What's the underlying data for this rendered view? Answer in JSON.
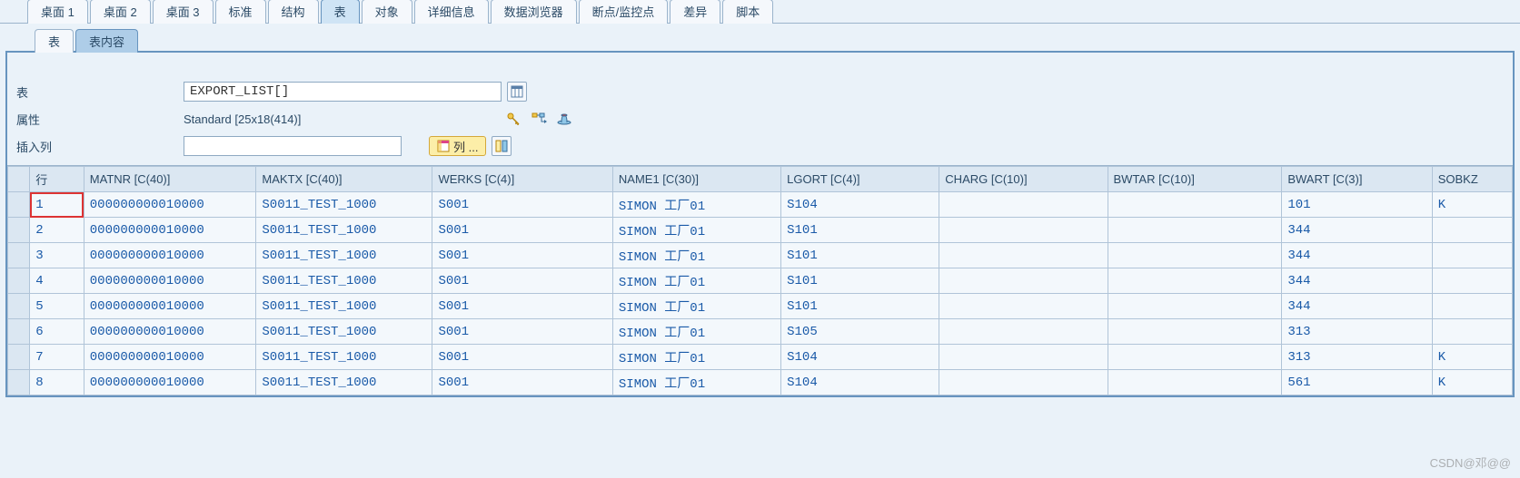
{
  "top_tabs": [
    {
      "label": "桌面 1"
    },
    {
      "label": "桌面 2"
    },
    {
      "label": "桌面 3"
    },
    {
      "label": "标准"
    },
    {
      "label": "结构"
    },
    {
      "label": "表",
      "active": true
    },
    {
      "label": "对象"
    },
    {
      "label": "详细信息"
    },
    {
      "label": "数据浏览器"
    },
    {
      "label": "断点/监控点"
    },
    {
      "label": "差异"
    },
    {
      "label": "脚本"
    }
  ],
  "sub_tabs": [
    {
      "label": "表"
    },
    {
      "label": "表内容",
      "active": true
    }
  ],
  "form": {
    "table_label": "表",
    "table_value": "EXPORT_LIST[]",
    "attr_label": "属性",
    "attr_value": "Standard [25x18(414)]",
    "insert_label": "插入列",
    "insert_value": "",
    "col_button_label": "列 ..."
  },
  "grid": {
    "row_header": "行",
    "columns": [
      {
        "key": "MATNR",
        "label": "MATNR [C(40)]",
        "cls": "col-matnr"
      },
      {
        "key": "MAKTX",
        "label": "MAKTX [C(40)]",
        "cls": "col-maktx"
      },
      {
        "key": "WERKS",
        "label": "WERKS [C(4)]",
        "cls": "col-werks"
      },
      {
        "key": "NAME1",
        "label": "NAME1 [C(30)]",
        "cls": "col-name1"
      },
      {
        "key": "LGORT",
        "label": "LGORT [C(4)]",
        "cls": "col-lgort"
      },
      {
        "key": "CHARG",
        "label": "CHARG [C(10)]",
        "cls": "col-charg"
      },
      {
        "key": "BWTAR",
        "label": "BWTAR [C(10)]",
        "cls": "col-bwtar"
      },
      {
        "key": "BWART",
        "label": "BWART [C(3)]",
        "cls": "col-bwart"
      },
      {
        "key": "SOBKZ",
        "label": "SOBKZ",
        "cls": "col-sobkz"
      }
    ],
    "rows": [
      {
        "n": "1",
        "active": true,
        "MATNR": "000000000010000",
        "MAKTX": "S0011_TEST_1000",
        "WERKS": "S001",
        "NAME1": "SIMON 工厂01",
        "LGORT": "S104",
        "CHARG": "",
        "BWTAR": "",
        "BWART": "101",
        "SOBKZ": "K"
      },
      {
        "n": "2",
        "MATNR": "000000000010000",
        "MAKTX": "S0011_TEST_1000",
        "WERKS": "S001",
        "NAME1": "SIMON 工厂01",
        "LGORT": "S101",
        "CHARG": "",
        "BWTAR": "",
        "BWART": "344",
        "SOBKZ": ""
      },
      {
        "n": "3",
        "MATNR": "000000000010000",
        "MAKTX": "S0011_TEST_1000",
        "WERKS": "S001",
        "NAME1": "SIMON 工厂01",
        "LGORT": "S101",
        "CHARG": "",
        "BWTAR": "",
        "BWART": "344",
        "SOBKZ": ""
      },
      {
        "n": "4",
        "MATNR": "000000000010000",
        "MAKTX": "S0011_TEST_1000",
        "WERKS": "S001",
        "NAME1": "SIMON 工厂01",
        "LGORT": "S101",
        "CHARG": "",
        "BWTAR": "",
        "BWART": "344",
        "SOBKZ": ""
      },
      {
        "n": "5",
        "MATNR": "000000000010000",
        "MAKTX": "S0011_TEST_1000",
        "WERKS": "S001",
        "NAME1": "SIMON 工厂01",
        "LGORT": "S101",
        "CHARG": "",
        "BWTAR": "",
        "BWART": "344",
        "SOBKZ": ""
      },
      {
        "n": "6",
        "MATNR": "000000000010000",
        "MAKTX": "S0011_TEST_1000",
        "WERKS": "S001",
        "NAME1": "SIMON 工厂01",
        "LGORT": "S105",
        "CHARG": "",
        "BWTAR": "",
        "BWART": "313",
        "SOBKZ": ""
      },
      {
        "n": "7",
        "MATNR": "000000000010000",
        "MAKTX": "S0011_TEST_1000",
        "WERKS": "S001",
        "NAME1": "SIMON 工厂01",
        "LGORT": "S104",
        "CHARG": "",
        "BWTAR": "",
        "BWART": "313",
        "SOBKZ": "K"
      },
      {
        "n": "8",
        "MATNR": "000000000010000",
        "MAKTX": "S0011_TEST_1000",
        "WERKS": "S001",
        "NAME1": "SIMON 工厂01",
        "LGORT": "S104",
        "CHARG": "",
        "BWTAR": "",
        "BWART": "561",
        "SOBKZ": "K"
      }
    ]
  },
  "watermark": "CSDN@邓@@"
}
